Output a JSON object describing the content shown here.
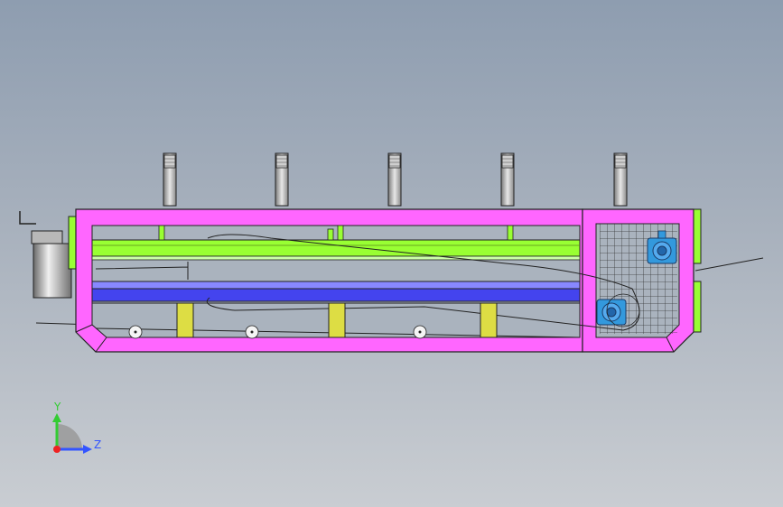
{
  "scene": {
    "background_top": "#8e9db0",
    "background_bottom": "#c9cdd2",
    "frame_color": "#ff66ff",
    "rail_green": "#99ff33",
    "rail_blue": "#4444ee",
    "support_yellow": "#dddd44",
    "bearing_blue": "#3399dd",
    "mesh_color": "#333333",
    "roller_count": 5,
    "support_post_count": 3,
    "bearing_count": 2,
    "pulley_count": 3
  },
  "triad": {
    "y_label": "Y",
    "z_label": "Z",
    "y_color": "#33cc33",
    "z_color": "#3355ff",
    "origin_color": "#ee2222"
  }
}
